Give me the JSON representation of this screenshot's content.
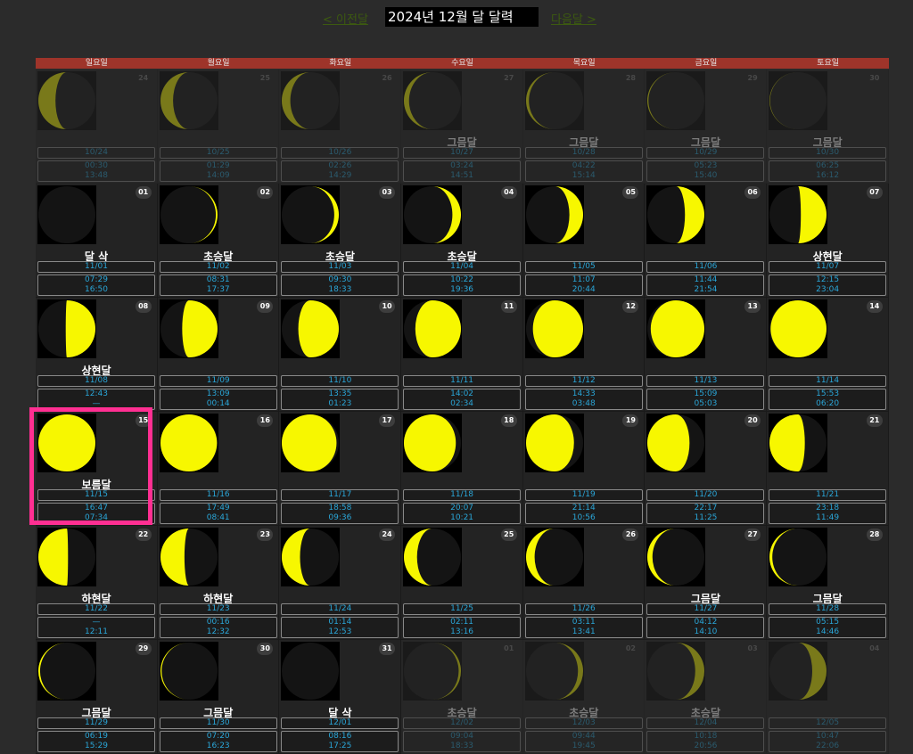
{
  "nav": {
    "prev": "< 이전달",
    "title": "2024년 12월 달 달력",
    "next": "다음달 >"
  },
  "weekdays": [
    "일요일",
    "월요일",
    "화요일",
    "수요일",
    "목요일",
    "금요일",
    "토요일"
  ],
  "colors": {
    "moon": "#f7f700",
    "header": "#9e342a",
    "highlight": "#ff2f92",
    "text_cyan": "#2aa6d8"
  },
  "cells": [
    {
      "day": "24",
      "phase": "",
      "lunar": "10/24",
      "rise": "00:30",
      "set": "13:48",
      "lit": 0.3,
      "waxing": false,
      "other": true
    },
    {
      "day": "25",
      "phase": "",
      "lunar": "10/25",
      "rise": "01:29",
      "set": "14:09",
      "lit": 0.22,
      "waxing": false,
      "other": true
    },
    {
      "day": "26",
      "phase": "",
      "lunar": "10/26",
      "rise": "02:26",
      "set": "14:29",
      "lit": 0.15,
      "waxing": false,
      "other": true
    },
    {
      "day": "27",
      "phase": "그믐달",
      "lunar": "10/27",
      "rise": "03:24",
      "set": "14:51",
      "lit": 0.09,
      "waxing": false,
      "other": true
    },
    {
      "day": "28",
      "phase": "그믐달",
      "lunar": "10/28",
      "rise": "04:22",
      "set": "15:14",
      "lit": 0.05,
      "waxing": false,
      "other": true
    },
    {
      "day": "29",
      "phase": "그믐달",
      "lunar": "10/29",
      "rise": "05:23",
      "set": "15:40",
      "lit": 0.02,
      "waxing": false,
      "other": true
    },
    {
      "day": "30",
      "phase": "그믐달",
      "lunar": "10/30",
      "rise": "06:25",
      "set": "16:12",
      "lit": 0.01,
      "waxing": false,
      "other": true
    },
    {
      "day": "01",
      "phase": "달 삭",
      "lunar": "11/01",
      "rise": "07:29",
      "set": "16:50",
      "lit": 0.0,
      "waxing": true,
      "other": false
    },
    {
      "day": "02",
      "phase": "초승달",
      "lunar": "11/02",
      "rise": "08:31",
      "set": "17:37",
      "lit": 0.03,
      "waxing": true,
      "other": false
    },
    {
      "day": "03",
      "phase": "초승달",
      "lunar": "11/03",
      "rise": "09:30",
      "set": "18:33",
      "lit": 0.08,
      "waxing": true,
      "other": false
    },
    {
      "day": "04",
      "phase": "초승달",
      "lunar": "11/04",
      "rise": "10:22",
      "set": "19:36",
      "lit": 0.15,
      "waxing": true,
      "other": false
    },
    {
      "day": "05",
      "phase": "",
      "lunar": "11/05",
      "rise": "11:07",
      "set": "20:44",
      "lit": 0.24,
      "waxing": true,
      "other": false
    },
    {
      "day": "06",
      "phase": "",
      "lunar": "11/06",
      "rise": "11:44",
      "set": "21:54",
      "lit": 0.34,
      "waxing": true,
      "other": false
    },
    {
      "day": "07",
      "phase": "상현달",
      "lunar": "11/07",
      "rise": "12:15",
      "set": "23:04",
      "lit": 0.45,
      "waxing": true,
      "other": false
    },
    {
      "day": "08",
      "phase": "상현달",
      "lunar": "11/08",
      "rise": "12:43",
      "set": "—",
      "lit": 0.52,
      "waxing": true,
      "other": false
    },
    {
      "day": "09",
      "phase": "",
      "lunar": "11/09",
      "rise": "13:09",
      "set": "00:14",
      "lit": 0.62,
      "waxing": true,
      "other": false
    },
    {
      "day": "10",
      "phase": "",
      "lunar": "11/10",
      "rise": "13:35",
      "set": "01:23",
      "lit": 0.71,
      "waxing": true,
      "other": false
    },
    {
      "day": "11",
      "phase": "",
      "lunar": "11/11",
      "rise": "14:02",
      "set": "02:34",
      "lit": 0.8,
      "waxing": true,
      "other": false
    },
    {
      "day": "12",
      "phase": "",
      "lunar": "11/12",
      "rise": "14:33",
      "set": "03:48",
      "lit": 0.88,
      "waxing": true,
      "other": false
    },
    {
      "day": "13",
      "phase": "",
      "lunar": "11/13",
      "rise": "15:09",
      "set": "05:03",
      "lit": 0.94,
      "waxing": true,
      "other": false
    },
    {
      "day": "14",
      "phase": "",
      "lunar": "11/14",
      "rise": "15:53",
      "set": "06:20",
      "lit": 0.98,
      "waxing": true,
      "other": false
    },
    {
      "day": "15",
      "phase": "보름달",
      "lunar": "11/15",
      "rise": "16:47",
      "set": "07:34",
      "lit": 1.0,
      "waxing": true,
      "other": false
    },
    {
      "day": "16",
      "phase": "",
      "lunar": "11/16",
      "rise": "17:49",
      "set": "08:41",
      "lit": 0.99,
      "waxing": false,
      "other": false
    },
    {
      "day": "17",
      "phase": "",
      "lunar": "11/17",
      "rise": "18:58",
      "set": "09:36",
      "lit": 0.96,
      "waxing": false,
      "other": false
    },
    {
      "day": "18",
      "phase": "",
      "lunar": "11/18",
      "rise": "20:07",
      "set": "10:21",
      "lit": 0.91,
      "waxing": false,
      "other": false
    },
    {
      "day": "19",
      "phase": "",
      "lunar": "11/19",
      "rise": "21:14",
      "set": "10:56",
      "lit": 0.84,
      "waxing": false,
      "other": false
    },
    {
      "day": "20",
      "phase": "",
      "lunar": "11/20",
      "rise": "22:17",
      "set": "11:25",
      "lit": 0.74,
      "waxing": false,
      "other": false
    },
    {
      "day": "21",
      "phase": "",
      "lunar": "11/21",
      "rise": "23:18",
      "set": "11:49",
      "lit": 0.62,
      "waxing": false,
      "other": false
    },
    {
      "day": "22",
      "phase": "하현달",
      "lunar": "11/22",
      "rise": "—",
      "set": "12:11",
      "lit": 0.52,
      "waxing": false,
      "other": false
    },
    {
      "day": "23",
      "phase": "하현달",
      "lunar": "11/23",
      "rise": "00:16",
      "set": "12:32",
      "lit": 0.42,
      "waxing": false,
      "other": false
    },
    {
      "day": "24",
      "phase": "",
      "lunar": "11/24",
      "rise": "01:14",
      "set": "12:53",
      "lit": 0.32,
      "waxing": false,
      "other": false
    },
    {
      "day": "25",
      "phase": "",
      "lunar": "11/25",
      "rise": "02:11",
      "set": "13:16",
      "lit": 0.23,
      "waxing": false,
      "other": false
    },
    {
      "day": "26",
      "phase": "",
      "lunar": "11/26",
      "rise": "03:11",
      "set": "13:41",
      "lit": 0.15,
      "waxing": false,
      "other": false
    },
    {
      "day": "27",
      "phase": "그믐달",
      "lunar": "11/27",
      "rise": "04:12",
      "set": "14:10",
      "lit": 0.09,
      "waxing": false,
      "other": false
    },
    {
      "day": "28",
      "phase": "그믐달",
      "lunar": "11/28",
      "rise": "05:15",
      "set": "14:46",
      "lit": 0.05,
      "waxing": false,
      "other": false
    },
    {
      "day": "29",
      "phase": "그믐달",
      "lunar": "11/29",
      "rise": "06:19",
      "set": "15:29",
      "lit": 0.03,
      "waxing": false,
      "other": false
    },
    {
      "day": "30",
      "phase": "그믐달",
      "lunar": "11/30",
      "rise": "07:20",
      "set": "16:23",
      "lit": 0.02,
      "waxing": false,
      "other": false
    },
    {
      "day": "31",
      "phase": "달 삭",
      "lunar": "12/01",
      "rise": "08:16",
      "set": "17:25",
      "lit": 0.0,
      "waxing": true,
      "other": false
    },
    {
      "day": "01",
      "phase": "초승달",
      "lunar": "12/02",
      "rise": "09:04",
      "set": "18:33",
      "lit": 0.04,
      "waxing": true,
      "other": true
    },
    {
      "day": "02",
      "phase": "초승달",
      "lunar": "12/03",
      "rise": "09:44",
      "set": "19:45",
      "lit": 0.09,
      "waxing": true,
      "other": true
    },
    {
      "day": "03",
      "phase": "초승달",
      "lunar": "12/04",
      "rise": "10:18",
      "set": "20:56",
      "lit": 0.16,
      "waxing": true,
      "other": true
    },
    {
      "day": "04",
      "phase": "",
      "lunar": "12/05",
      "rise": "10:47",
      "set": "22:06",
      "lit": 0.25,
      "waxing": true,
      "other": true
    }
  ]
}
